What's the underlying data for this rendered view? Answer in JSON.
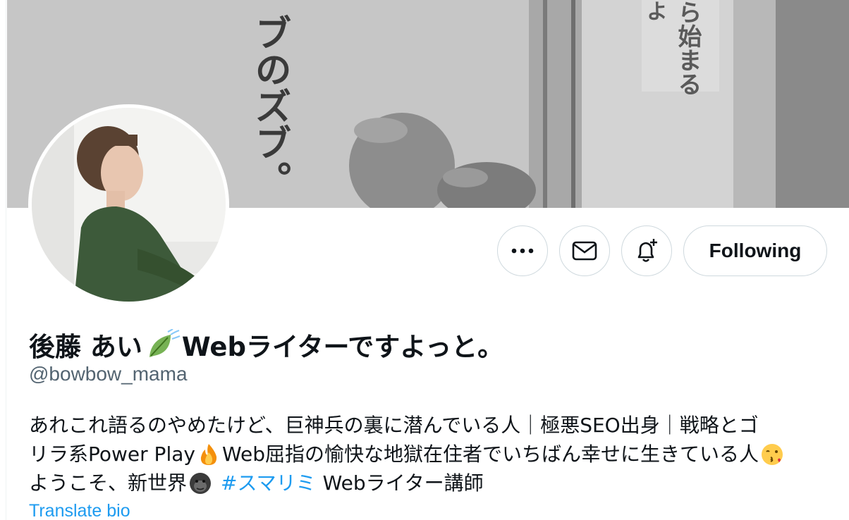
{
  "profile": {
    "name_main": "後藤 あい",
    "name_rest": "Webライターですよっと。",
    "handle": "@bowbow_mama",
    "bio_line1": "あれこれ語るのやめたけど、巨神兵の裏に潜んでいる人｜極悪SEO出身｜戦略とゴ",
    "bio_line2a": "リラ系Power Play",
    "bio_line2b": "Web屈指の愉快な地獄在住者でいちばん幸せに生きている人",
    "bio_line3a": "ようこそ、新世界",
    "bio_hashtag": "#スマリミ",
    "bio_line3b": "Webライター講師",
    "translate_label": "Translate bio"
  },
  "banner": {
    "text_left": "ブのズブ。",
    "text_right": "ら始まる",
    "text_corner": "よ"
  },
  "actions": {
    "following_label": "Following",
    "more_icon": "ellipsis-icon",
    "mail_icon": "envelope-icon",
    "notify_icon": "bell-plus-icon"
  },
  "colors": {
    "link": "#1d9bf0",
    "secondary_text": "#536471",
    "border": "#cfd9de"
  },
  "emojis": [
    "leaf-fluttering-emoji",
    "fire-emoji",
    "kissing-face-emoji",
    "gorilla-emoji"
  ]
}
